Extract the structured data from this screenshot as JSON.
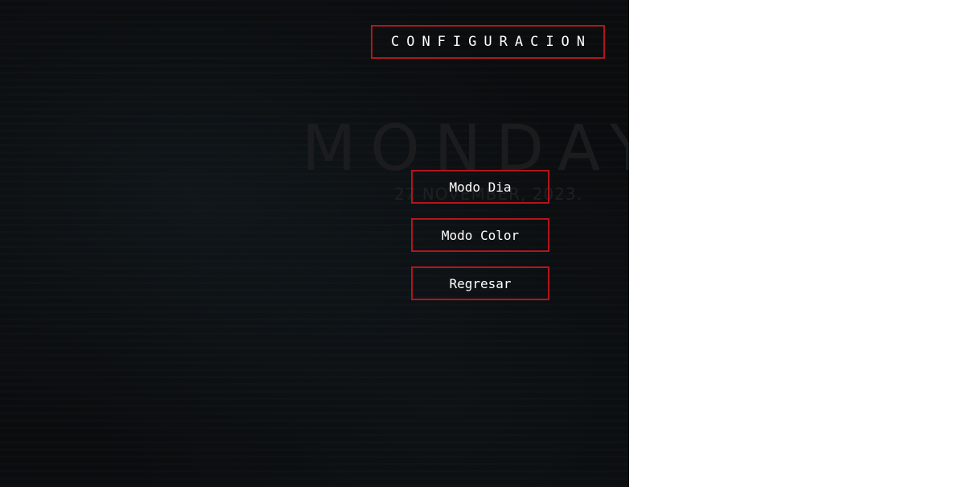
{
  "background": {
    "day_text": "MONDAY",
    "date_text": "27 NOVEMBER, 2023."
  },
  "header": {
    "title": "CONFIGURACION"
  },
  "menu": {
    "items": [
      {
        "label": "Modo Dia"
      },
      {
        "label": "Modo Color"
      },
      {
        "label": "Regresar"
      }
    ]
  },
  "colors": {
    "panel_background": "#0b0c0d",
    "accent_border": "#b3151d",
    "text": "#ffffff"
  }
}
